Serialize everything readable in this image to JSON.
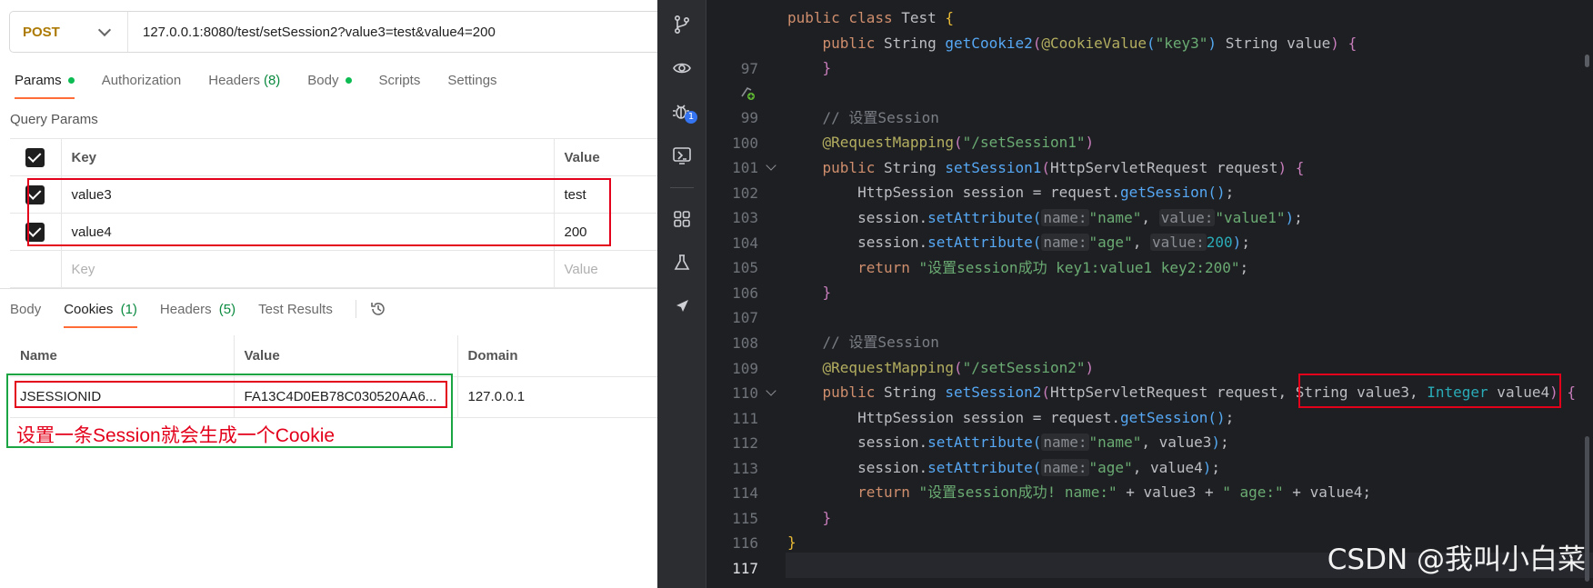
{
  "request": {
    "method": "POST",
    "url": "127.0.0.1:8080/test/setSession2?value3=test&value4=200"
  },
  "request_tabs": [
    {
      "label": "Params",
      "count": "",
      "dot": true
    },
    {
      "label": "Authorization",
      "count": "",
      "dot": false
    },
    {
      "label": "Headers",
      "count": "(8)",
      "dot": false
    },
    {
      "label": "Body",
      "count": "",
      "dot": true
    },
    {
      "label": "Scripts",
      "count": "",
      "dot": false
    },
    {
      "label": "Settings",
      "count": "",
      "dot": false
    }
  ],
  "query_params": {
    "title": "Query Params",
    "col_key": "Key",
    "col_value": "Value",
    "rows": [
      {
        "key": "value3",
        "value": "test"
      },
      {
        "key": "value4",
        "value": "200"
      }
    ],
    "placeholder_key": "Key",
    "placeholder_value": "Value"
  },
  "response_tabs": [
    {
      "label": "Body",
      "count": ""
    },
    {
      "label": "Cookies",
      "count": "(1)"
    },
    {
      "label": "Headers",
      "count": "(5)"
    },
    {
      "label": "Test Results",
      "count": ""
    }
  ],
  "cookies": {
    "col_name": "Name",
    "col_value": "Value",
    "col_domain": "Domain",
    "rows": [
      {
        "name": "JSESSIONID",
        "value": "FA13C4D0EB78C030520AA6...",
        "domain": "127.0.0.1"
      }
    ]
  },
  "annotation": "设置一条Session就会生成一个Cookie",
  "editor": {
    "header": "public class Test {",
    "line_numbers": [
      "97",
      "99",
      "100",
      "101",
      "102",
      "103",
      "104",
      "105",
      "106",
      "107",
      "108",
      "109",
      "110",
      "111",
      "112",
      "113",
      "114",
      "115",
      "116",
      "117"
    ],
    "sticky_line": "public String getCookie2(@CookieValue(\"key3\") String value) {",
    "comment1": "// 设置Session",
    "mapping1": "\"/setSession1\"",
    "method1": "setSession1",
    "str_name1": "\"name\"",
    "str_value1": "\"value1\"",
    "str_age1": "\"age\"",
    "num_200": "200",
    "return1": "\"设置session成功 key1:value1 key2:200\"",
    "comment2": "// 设置Session",
    "mapping2": "\"/setSession2\"",
    "method2": "setSession2",
    "str_name2": "\"name\"",
    "str_age2": "\"age\"",
    "return2a": "\"设置session成功! name:\"",
    "return2b": "\" age:\""
  },
  "watermark": "CSDN @我叫小白菜",
  "colors": {
    "accent_tab": "#ff6c37",
    "annotation_red": "#e3001b",
    "annotation_green": "#1aa542",
    "method_post": "#ad7a03"
  }
}
